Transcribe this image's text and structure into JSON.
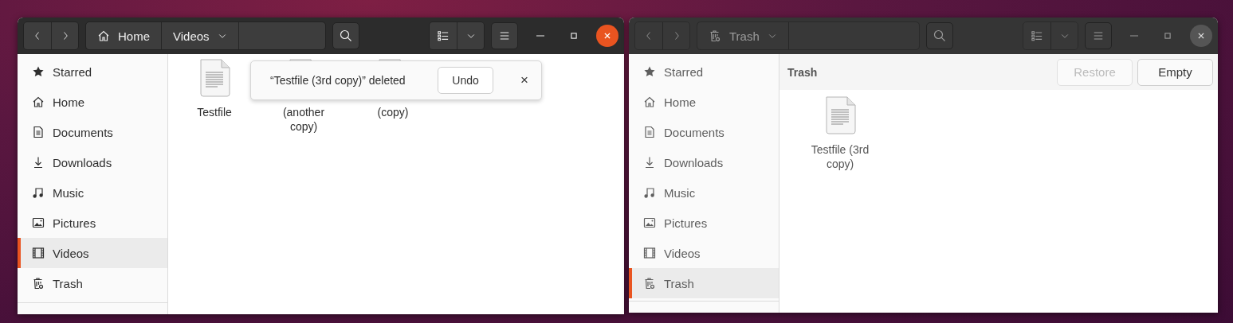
{
  "windows": [
    {
      "active": true,
      "pathbar": [
        {
          "label": "Home",
          "kind": "home",
          "dropdown": false
        },
        {
          "label": "Videos",
          "kind": "folder",
          "dropdown": true
        }
      ],
      "sidebar": [
        {
          "label": "Starred",
          "kind": "starred",
          "selected": false
        },
        {
          "label": "Home",
          "kind": "home",
          "selected": false
        },
        {
          "label": "Documents",
          "kind": "documents",
          "selected": false
        },
        {
          "label": "Downloads",
          "kind": "downloads",
          "selected": false
        },
        {
          "label": "Music",
          "kind": "music",
          "selected": false
        },
        {
          "label": "Pictures",
          "kind": "pictures",
          "selected": false
        },
        {
          "label": "Videos",
          "kind": "videos",
          "selected": true
        },
        {
          "label": "Trash",
          "kind": "trash",
          "selected": false
        }
      ],
      "files": [
        {
          "label": "Testfile"
        },
        {
          "label": "(another copy)"
        },
        {
          "label": "(copy)"
        }
      ],
      "toast": {
        "message": "“Testfile (3rd copy)” deleted",
        "action": "Undo",
        "close": "×"
      }
    },
    {
      "active": false,
      "pathbar": [
        {
          "label": "Trash",
          "kind": "trash",
          "dropdown": true
        }
      ],
      "sidebar": [
        {
          "label": "Starred",
          "kind": "starred",
          "selected": false
        },
        {
          "label": "Home",
          "kind": "home",
          "selected": false
        },
        {
          "label": "Documents",
          "kind": "documents",
          "selected": false
        },
        {
          "label": "Downloads",
          "kind": "downloads",
          "selected": false
        },
        {
          "label": "Music",
          "kind": "music",
          "selected": false
        },
        {
          "label": "Pictures",
          "kind": "pictures",
          "selected": false
        },
        {
          "label": "Videos",
          "kind": "videos",
          "selected": false
        },
        {
          "label": "Trash",
          "kind": "trash",
          "selected": true
        }
      ],
      "header": {
        "title": "Trash",
        "buttons": [
          {
            "label": "Restore",
            "disabled": true
          },
          {
            "label": "Empty",
            "disabled": false
          }
        ]
      },
      "files": [
        {
          "label": "Testfile (3rd copy)"
        }
      ]
    }
  ]
}
